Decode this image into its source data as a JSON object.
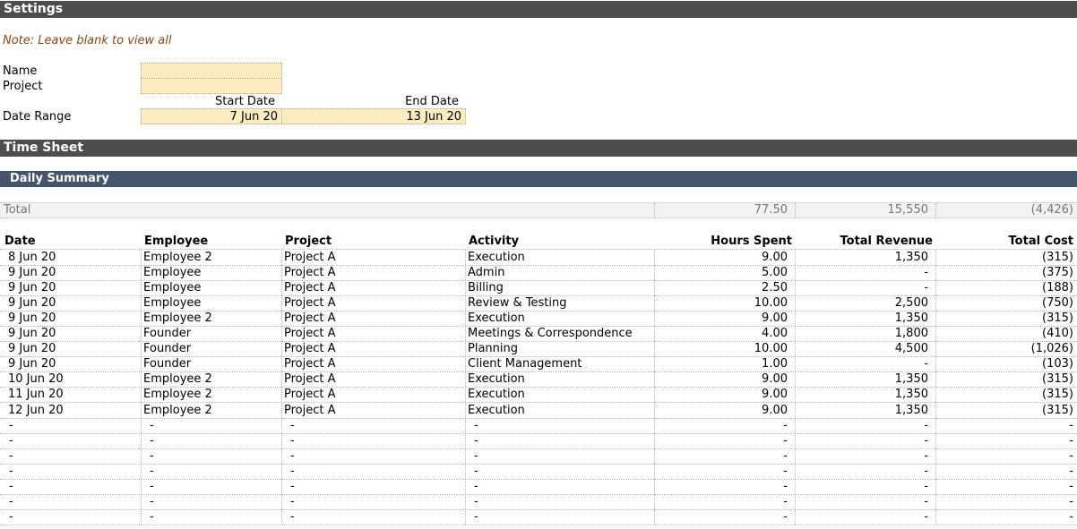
{
  "settings": {
    "title": "Settings",
    "note": "Note: Leave blank to view all",
    "name_label": "Name",
    "name_value": "",
    "project_label": "Project",
    "project_value": "",
    "start_date_label": "Start Date",
    "end_date_label": "End Date",
    "date_range_label": "Date Range",
    "start_date_value": "7 Jun 20",
    "end_date_value": "13 Jun 20"
  },
  "timesheet": {
    "title": "Time Sheet",
    "section": "Daily Summary",
    "total": {
      "label": "Total",
      "hours": "77.50",
      "revenue": "15,550",
      "cost": "(4,426)"
    },
    "columns": [
      "Date",
      "Employee",
      "Project",
      "Activity",
      "Hours Spent",
      "Total Revenue",
      "Total Cost"
    ],
    "rows": [
      [
        "8 Jun 20",
        "Employee 2",
        "Project A",
        "Execution",
        "9.00",
        "1,350",
        "(315)"
      ],
      [
        "9 Jun 20",
        "Employee",
        "Project A",
        "Admin",
        "5.00",
        "-",
        "(375)"
      ],
      [
        "9 Jun 20",
        "Employee",
        "Project A",
        "Billing",
        "2.50",
        "-",
        "(188)"
      ],
      [
        "9 Jun 20",
        "Employee",
        "Project A",
        "Review & Testing",
        "10.00",
        "2,500",
        "(750)"
      ],
      [
        "9 Jun 20",
        "Employee 2",
        "Project A",
        "Execution",
        "9.00",
        "1,350",
        "(315)"
      ],
      [
        "9 Jun 20",
        "Founder",
        "Project A",
        "Meetings & Correspondence",
        "4.00",
        "1,800",
        "(410)"
      ],
      [
        "9 Jun 20",
        "Founder",
        "Project A",
        "Planning",
        "10.00",
        "4,500",
        "(1,026)"
      ],
      [
        "9 Jun 20",
        "Founder",
        "Project A",
        "Client Management",
        "1.00",
        "-",
        "(103)"
      ],
      [
        "10 Jun 20",
        "Employee 2",
        "Project A",
        "Execution",
        "9.00",
        "1,350",
        "(315)"
      ],
      [
        "11 Jun 20",
        "Employee 2",
        "Project A",
        "Execution",
        "9.00",
        "1,350",
        "(315)"
      ],
      [
        "12 Jun 20",
        "Employee 2",
        "Project A",
        "Execution",
        "9.00",
        "1,350",
        "(315)"
      ],
      [
        "-",
        "-",
        "-",
        "-",
        "-",
        "-",
        "-"
      ],
      [
        "-",
        "-",
        "-",
        "-",
        "-",
        "-",
        "-"
      ],
      [
        "-",
        "-",
        "-",
        "-",
        "-",
        "-",
        "-"
      ],
      [
        "-",
        "-",
        "-",
        "-",
        "-",
        "-",
        "-"
      ],
      [
        "-",
        "-",
        "-",
        "-",
        "-",
        "-",
        "-"
      ],
      [
        "-",
        "-",
        "-",
        "-",
        "-",
        "-",
        "-"
      ],
      [
        "-",
        "-",
        "-",
        "-",
        "-",
        "-",
        "-"
      ]
    ]
  }
}
